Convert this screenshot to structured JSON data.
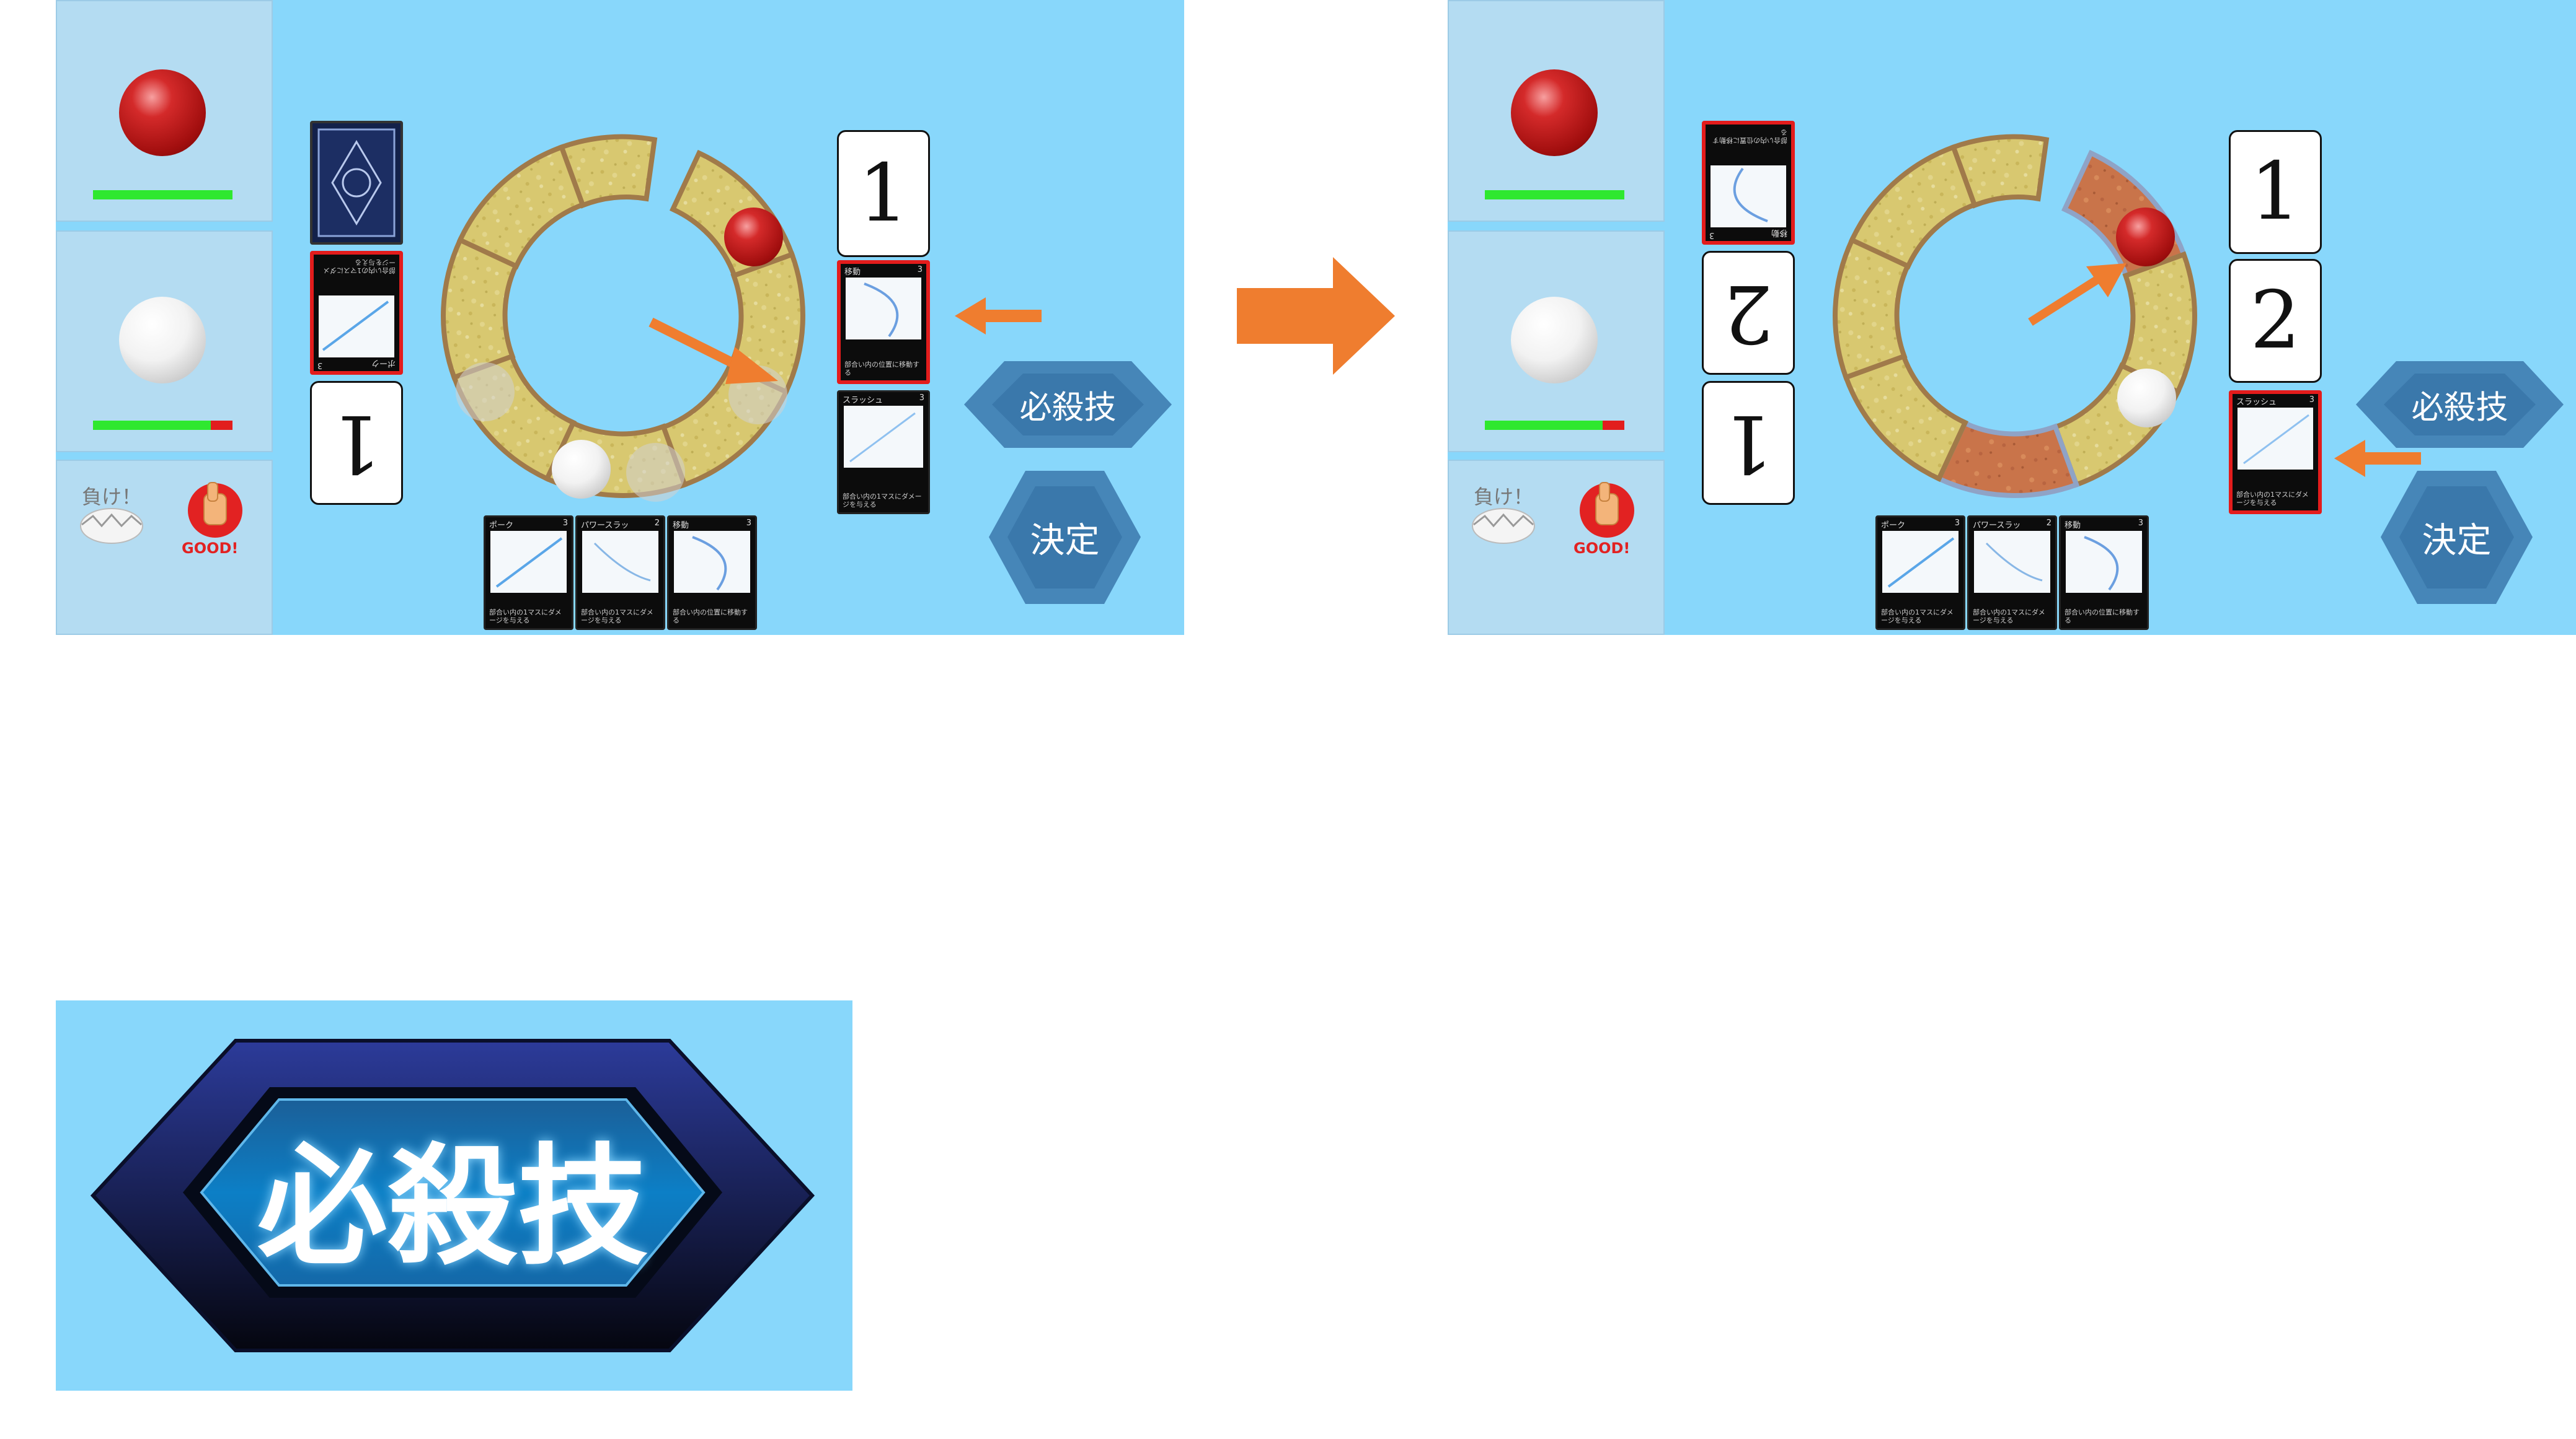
{
  "flow_arrow": {
    "color": "#ef7d2f"
  },
  "screens": [
    {
      "id": "before",
      "gauges": {
        "red_hp_fraction": 1.0,
        "white_hp_fraction": 0.83
      },
      "stamp": {
        "text1": "負け！",
        "text2": "GOOD!"
      },
      "left_number_card": "1",
      "right_number_cards": [
        "1"
      ],
      "special_button": "必殺技",
      "decide_button": "決定",
      "selected_card": {
        "title": "移動",
        "cost": "3",
        "desc": "部合い内の位置に移動する"
      },
      "slash_card": {
        "title": "スラッシュ",
        "cost": "3",
        "desc": "部合い内の1マスにダメージを与える"
      },
      "played_card": {
        "title": "ポーク",
        "cost": "3",
        "desc": "部合い内の1マスにダメージを与える"
      },
      "hand": [
        {
          "title": "ポーク",
          "cost": "3",
          "desc": "部合い内の1マスにダメージを与える"
        },
        {
          "title": "パワースラッ",
          "cost": "2",
          "desc": "部合い内の1マスにダメージを与える"
        },
        {
          "title": "移動",
          "cost": "3",
          "desc": "部合い内の位置に移動する"
        }
      ]
    },
    {
      "id": "after",
      "gauges": {
        "red_hp_fraction": 1.0,
        "white_hp_fraction": 0.83
      },
      "stamp": {
        "text1": "負け！",
        "text2": "GOOD!"
      },
      "left_number_cards": [
        "2",
        "1"
      ],
      "right_number_cards": [
        "1",
        "2"
      ],
      "special_button": "必殺技",
      "decide_button": "決定",
      "opponent_card": {
        "title": "移動",
        "cost": "3",
        "desc": "部合い内の位置に移動する"
      },
      "selected_card": {
        "title": "スラッシュ",
        "cost": "3",
        "desc": "部合い内の1マスにダメージを与える"
      },
      "hand": [
        {
          "title": "ポーク",
          "cost": "3",
          "desc": "部合い内の1マスにダメージを与える"
        },
        {
          "title": "パワースラッ",
          "cost": "2",
          "desc": "部合い内の1マスにダメージを与える"
        },
        {
          "title": "移動",
          "cost": "3",
          "desc": "部合い内の位置に移動する"
        }
      ]
    }
  ],
  "closeup": {
    "label": "必殺技"
  }
}
